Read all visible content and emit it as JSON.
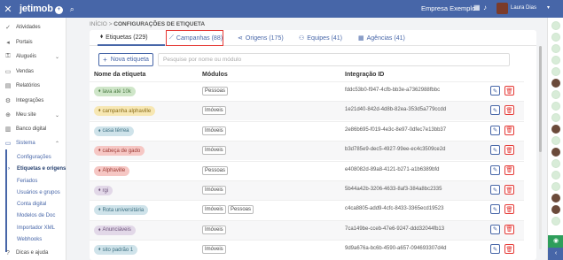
{
  "topbar": {
    "close_icon": "close-icon",
    "brand": "jetimob",
    "brand_badge": "+",
    "company": "Empresa Exemplo",
    "user_name": "Laura Dias"
  },
  "sidebar": {
    "items": [
      {
        "label": "Atividades",
        "icon": "check-circle-icon",
        "glyph": "✓"
      },
      {
        "label": "Portais",
        "icon": "megaphone-icon",
        "glyph": "◂"
      },
      {
        "label": "Aluguéis",
        "icon": "key-icon",
        "glyph": "⚿"
      },
      {
        "label": "Vendas",
        "icon": "handshake-icon",
        "glyph": "▭"
      },
      {
        "label": "Relatórios",
        "icon": "report-icon",
        "glyph": "▤"
      },
      {
        "label": "Integrações",
        "icon": "gear-icon",
        "glyph": "⚙"
      },
      {
        "label": "Meu site",
        "icon": "globe-icon",
        "glyph": "⊕"
      },
      {
        "label": "Banco digital",
        "icon": "bank-icon",
        "glyph": "▥"
      },
      {
        "label": "Sistema",
        "icon": "monitor-icon",
        "glyph": "▭"
      }
    ],
    "sub_items": [
      "Configurações",
      "Etiquetas e origens",
      "Feriados",
      "Usuários e grupos",
      "Conta digital",
      "Modelos de Doc",
      "Importador XML",
      "Webhooks"
    ],
    "footer": "Dicas e ajuda"
  },
  "breadcrumb": {
    "home": "INÍCIO",
    "sep": ">",
    "current": "CONFIGURAÇÕES DE ETIQUETA"
  },
  "tabs": [
    {
      "label": "Etiquetas (229)",
      "icon": "tag-icon",
      "glyph": "⬧"
    },
    {
      "label": "Campanhas (88)",
      "icon": "chart-icon",
      "glyph": "⟋"
    },
    {
      "label": "Origens (175)",
      "icon": "share-icon",
      "glyph": "⋖"
    },
    {
      "label": "Equipes (41)",
      "icon": "users-icon",
      "glyph": "⚇"
    },
    {
      "label": "Agências (41)",
      "icon": "building-icon",
      "glyph": "▦"
    }
  ],
  "toolbar": {
    "new_label": "Nova etiqueta",
    "search_placeholder": "Pesquise por nome ou módulo"
  },
  "table": {
    "headers": [
      "Nome da etiqueta",
      "Módulos",
      "Integração ID"
    ],
    "rows": [
      {
        "name": "lava até 10k",
        "color": "#cfe6c9",
        "text": "#4a7a42",
        "modules": [
          "Pessoas"
        ],
        "id": "fddc53b0-f947-4cfb-bb3e-a7362988fbbc"
      },
      {
        "name": "campanha alphaville",
        "color": "#f7e7b3",
        "text": "#8a6d1a",
        "modules": [
          "Imóveis"
        ],
        "id": "1e21d40-842d-4d8b-82ea-353d5a779ccdd"
      },
      {
        "name": "casa térrea",
        "color": "#cfe3ea",
        "text": "#3d6f80",
        "modules": [
          "Imóveis"
        ],
        "id": "2e86b695-f019-4e3c-8e97-0dfec7e13bb37"
      },
      {
        "name": "cabeça de gado",
        "color": "#f6c7c4",
        "text": "#9a3a34",
        "modules": [
          "Imóveis"
        ],
        "id": "b3d785e9-dec5-4927-99ee-ec4c3509ce2d"
      },
      {
        "name": "Alphaville",
        "color": "#f6c7c4",
        "text": "#9a3a34",
        "modules": [
          "Pessoas"
        ],
        "id": "e408082d-89a8-4121-b271-a1b6389bfd"
      },
      {
        "name": "rgi",
        "color": "#e2d8e8",
        "text": "#6d547a",
        "modules": [
          "Imóveis"
        ],
        "id": "5b44a42b-3206-4633-8af3-384a8bc2335"
      },
      {
        "name": "Rota universitária",
        "color": "#cfe3ea",
        "text": "#3d6f80",
        "modules": [
          "Imóveis",
          "Pessoas"
        ],
        "id": "c4ca8805-add9-4cfc-8433-3365ecd19523"
      },
      {
        "name": "Anunciáveis",
        "color": "#e2d8e8",
        "text": "#6d547a",
        "modules": [
          "Imóveis"
        ],
        "id": "7ca149be-cceb-47e6-9247-ddd32044fb13"
      },
      {
        "name": "sito padrão 1",
        "color": "#cfe3ea",
        "text": "#3d6f80",
        "modules": [
          "Imóveis"
        ],
        "id": "9d9a676a-bc6b-4590-a657-094693307d4d"
      }
    ]
  }
}
